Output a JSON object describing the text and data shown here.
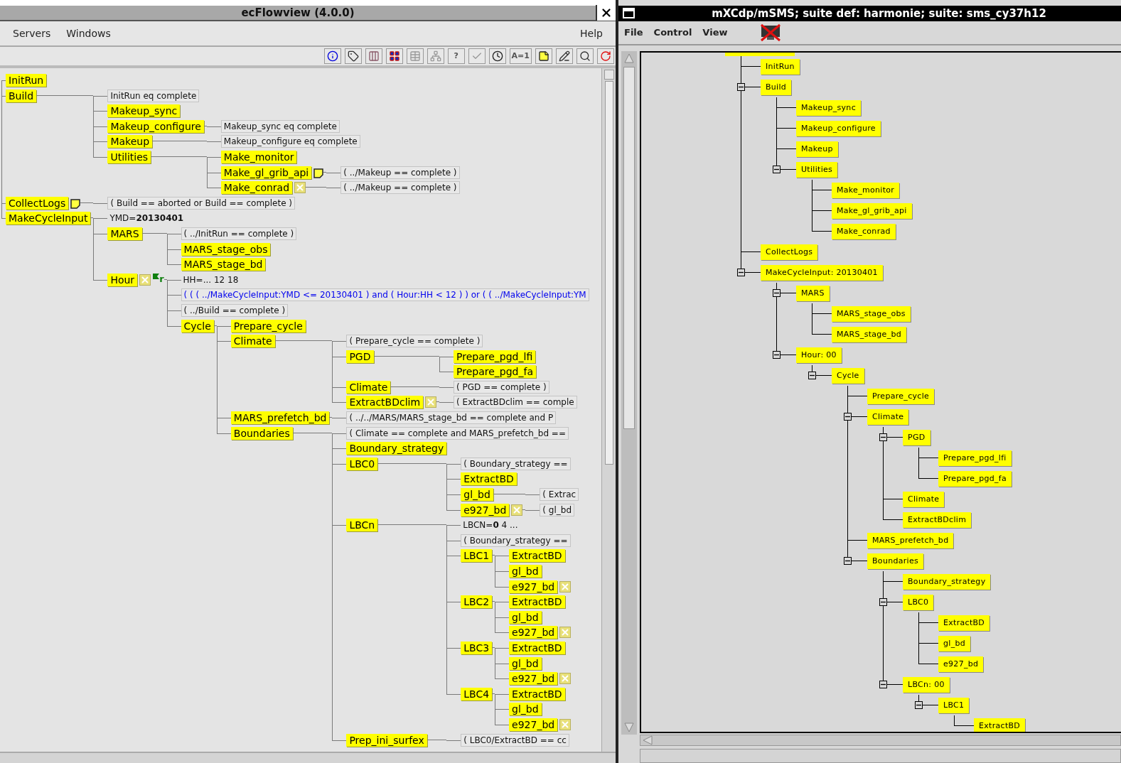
{
  "left_window": {
    "title": "ecFlowview (4.0.0)",
    "menu": [
      "Servers",
      "Windows"
    ],
    "help_menu": "Help",
    "toolbar": [
      {
        "kind": "info"
      },
      {
        "kind": "tag"
      },
      {
        "kind": "bars"
      },
      {
        "kind": "colors"
      },
      {
        "kind": "table"
      },
      {
        "kind": "tree"
      },
      {
        "kind": "text",
        "text": "?"
      },
      {
        "kind": "check"
      },
      {
        "kind": "clock"
      },
      {
        "kind": "text",
        "text": "A=1"
      },
      {
        "kind": "note"
      },
      {
        "kind": "edit"
      },
      {
        "kind": "search"
      },
      {
        "kind": "refresh"
      }
    ],
    "tree": [
      {
        "kind": "node",
        "name": "InitRun"
      },
      {
        "kind": "node",
        "name": "Build",
        "items": [
          {
            "kind": "trigger",
            "text": "InitRun eq complete"
          },
          {
            "kind": "node",
            "name": "Makeup_sync"
          },
          {
            "kind": "node",
            "name": "Makeup_configure",
            "items": [
              {
                "kind": "trigger",
                "text": "Makeup_sync eq complete"
              }
            ]
          },
          {
            "kind": "node",
            "name": "Makeup",
            "items": [
              {
                "kind": "trigger",
                "text": "Makeup_configure eq complete"
              }
            ]
          },
          {
            "kind": "node",
            "name": "Utilities",
            "items": [
              {
                "kind": "node",
                "name": "Make_monitor"
              },
              {
                "kind": "node",
                "name": "Make_gl_grib_api",
                "icons": [
                  {
                    "kind": "note"
                  }
                ],
                "items": [
                  {
                    "kind": "trigger",
                    "text": "( ../Makeup == complete )"
                  }
                ]
              },
              {
                "kind": "node",
                "name": "Make_conrad",
                "icons": [
                  {
                    "kind": "late"
                  }
                ],
                "items": [
                  {
                    "kind": "trigger",
                    "text": "( ../Makeup == complete )"
                  }
                ]
              }
            ]
          }
        ]
      },
      {
        "kind": "node",
        "name": "CollectLogs",
        "icons": [
          {
            "kind": "note"
          }
        ],
        "items": [
          {
            "kind": "trigger",
            "text": "( Build == aborted or Build == complete )"
          }
        ]
      },
      {
        "kind": "node",
        "name": "MakeCycleInput",
        "items": [
          {
            "kind": "attribute",
            "text": "YMD=**20130401**"
          },
          {
            "kind": "node",
            "name": "MARS",
            "items": [
              {
                "kind": "trigger",
                "text": "( ../InitRun == complete )"
              },
              {
                "kind": "node",
                "name": "MARS_stage_obs"
              },
              {
                "kind": "node",
                "name": "MARS_stage_bd"
              }
            ]
          },
          {
            "kind": "node",
            "name": "Hour",
            "icons": [
              {
                "kind": "late"
              },
              {
                "kind": "repeat",
                "text": "r"
              }
            ],
            "items": [
              {
                "kind": "attribute",
                "text": "HH=... 12 18"
              },
              {
                "kind": "complete",
                "text": "( ( ( ../MakeCycleInput:YMD <= 20130401 ) and ( Hour:HH < 12 ) ) or ( ( ../MakeCycleInput:YM"
              },
              {
                "kind": "trigger",
                "text": "( ../Build == complete )"
              },
              {
                "kind": "node",
                "name": "Cycle",
                "items": [
                  {
                    "kind": "node",
                    "name": "Prepare_cycle"
                  },
                  {
                    "kind": "node",
                    "name": "Climate",
                    "items": [
                      {
                        "kind": "trigger",
                        "text": "( Prepare_cycle == complete )"
                      },
                      {
                        "kind": "node",
                        "name": "PGD",
                        "items": [
                          {
                            "kind": "node",
                            "name": "Prepare_pgd_lfi"
                          },
                          {
                            "kind": "node",
                            "name": "Prepare_pgd_fa"
                          }
                        ]
                      },
                      {
                        "kind": "node",
                        "name": "Climate",
                        "items": [
                          {
                            "kind": "trigger",
                            "text": "( PGD == complete )"
                          }
                        ]
                      },
                      {
                        "kind": "node",
                        "name": "ExtractBDclim",
                        "icons": [
                          {
                            "kind": "late"
                          }
                        ],
                        "items": [
                          {
                            "kind": "trigger",
                            "text": "( ExtractBDclim == comple"
                          }
                        ]
                      }
                    ]
                  },
                  {
                    "kind": "node",
                    "name": "MARS_prefetch_bd",
                    "items": [
                      {
                        "kind": "trigger",
                        "text": "( ../../MARS/MARS_stage_bd == complete and P"
                      }
                    ]
                  },
                  {
                    "kind": "node",
                    "name": "Boundaries",
                    "items": [
                      {
                        "kind": "trigger",
                        "text": "( Climate == complete and MARS_prefetch_bd =="
                      },
                      {
                        "kind": "node",
                        "name": "Boundary_strategy"
                      },
                      {
                        "kind": "node",
                        "name": "LBC0",
                        "items": [
                          {
                            "kind": "trigger",
                            "text": "( Boundary_strategy =="
                          },
                          {
                            "kind": "node",
                            "name": "ExtractBD"
                          },
                          {
                            "kind": "node",
                            "name": "gl_bd",
                            "items": [
                              {
                                "kind": "trigger",
                                "text": "( Extrac"
                              }
                            ]
                          },
                          {
                            "kind": "node",
                            "name": "e927_bd",
                            "icons": [
                              {
                                "kind": "late"
                              }
                            ],
                            "items": [
                              {
                                "kind": "trigger",
                                "text": "( gl_bd"
                              }
                            ]
                          }
                        ]
                      },
                      {
                        "kind": "node",
                        "name": "LBCn",
                        "items": [
                          {
                            "kind": "attribute",
                            "text": "LBCN=**0** 4 ..."
                          },
                          {
                            "kind": "trigger",
                            "text": "( Boundary_strategy =="
                          },
                          {
                            "kind": "node",
                            "name": "LBC1",
                            "items": [
                              {
                                "kind": "node",
                                "name": "ExtractBD"
                              },
                              {
                                "kind": "node",
                                "name": "gl_bd"
                              },
                              {
                                "kind": "node",
                                "name": "e927_bd",
                                "icons": [
                                  {
                                    "kind": "late"
                                  }
                                ]
                              }
                            ]
                          },
                          {
                            "kind": "node",
                            "name": "LBC2",
                            "items": [
                              {
                                "kind": "node",
                                "name": "ExtractBD"
                              },
                              {
                                "kind": "node",
                                "name": "gl_bd"
                              },
                              {
                                "kind": "node",
                                "name": "e927_bd",
                                "icons": [
                                  {
                                    "kind": "late"
                                  }
                                ]
                              }
                            ]
                          },
                          {
                            "kind": "node",
                            "name": "LBC3",
                            "items": [
                              {
                                "kind": "node",
                                "name": "ExtractBD"
                              },
                              {
                                "kind": "node",
                                "name": "gl_bd"
                              },
                              {
                                "kind": "node",
                                "name": "e927_bd",
                                "icons": [
                                  {
                                    "kind": "late"
                                  }
                                ]
                              }
                            ]
                          },
                          {
                            "kind": "node",
                            "name": "LBC4",
                            "items": [
                              {
                                "kind": "node",
                                "name": "ExtractBD"
                              },
                              {
                                "kind": "node",
                                "name": "gl_bd"
                              },
                              {
                                "kind": "node",
                                "name": "e927_bd",
                                "icons": [
                                  {
                                    "kind": "late"
                                  }
                                ]
                              }
                            ]
                          }
                        ]
                      },
                      {
                        "kind": "node",
                        "name": "Prep_ini_surfex",
                        "items": [
                          {
                            "kind": "trigger",
                            "text": "( LBC0/ExtractBD == cc"
                          }
                        ]
                      }
                    ]
                  }
                ]
              }
            ]
          }
        ]
      }
    ]
  },
  "right_window": {
    "title": "mXCdp/mSMS; suite def: harmonie; suite:  sms_cy37h12",
    "menu": [
      "File",
      "Control",
      "View"
    ],
    "tree": [
      {
        "name": "InitRun"
      },
      {
        "name": "Build",
        "expanded": true,
        "children": [
          {
            "name": "Makeup_sync"
          },
          {
            "name": "Makeup_configure"
          },
          {
            "name": "Makeup"
          },
          {
            "name": "Utilities",
            "expanded": true,
            "children": [
              {
                "name": "Make_monitor"
              },
              {
                "name": "Make_gl_grib_api"
              },
              {
                "name": "Make_conrad"
              }
            ]
          }
        ]
      },
      {
        "name": "CollectLogs"
      },
      {
        "name": "MakeCycleInput: 20130401",
        "expanded": true,
        "children": [
          {
            "name": "MARS",
            "expanded": true,
            "children": [
              {
                "name": "MARS_stage_obs"
              },
              {
                "name": "MARS_stage_bd"
              }
            ]
          },
          {
            "name": "Hour: 00",
            "expanded": true,
            "children": [
              {
                "name": "Cycle",
                "expanded": true,
                "children": [
                  {
                    "name": "Prepare_cycle"
                  },
                  {
                    "name": "Climate",
                    "expanded": true,
                    "children": [
                      {
                        "name": "PGD",
                        "expanded": true,
                        "children": [
                          {
                            "name": "Prepare_pgd_lfi"
                          },
                          {
                            "name": "Prepare_pgd_fa"
                          }
                        ]
                      },
                      {
                        "name": "Climate"
                      },
                      {
                        "name": "ExtractBDclim"
                      }
                    ]
                  },
                  {
                    "name": "MARS_prefetch_bd"
                  },
                  {
                    "name": "Boundaries",
                    "expanded": true,
                    "children": [
                      {
                        "name": "Boundary_strategy"
                      },
                      {
                        "name": "LBC0",
                        "expanded": true,
                        "children": [
                          {
                            "name": "ExtractBD"
                          },
                          {
                            "name": "gl_bd"
                          },
                          {
                            "name": "e927_bd"
                          }
                        ]
                      },
                      {
                        "name": "LBCn: 00",
                        "expanded": true,
                        "children": [
                          {
                            "name": "LBC1",
                            "expanded": true,
                            "children": [
                              {
                                "name": "ExtractBD"
                              }
                            ]
                          }
                        ]
                      }
                    ]
                  }
                ]
              }
            ]
          }
        ]
      }
    ]
  }
}
